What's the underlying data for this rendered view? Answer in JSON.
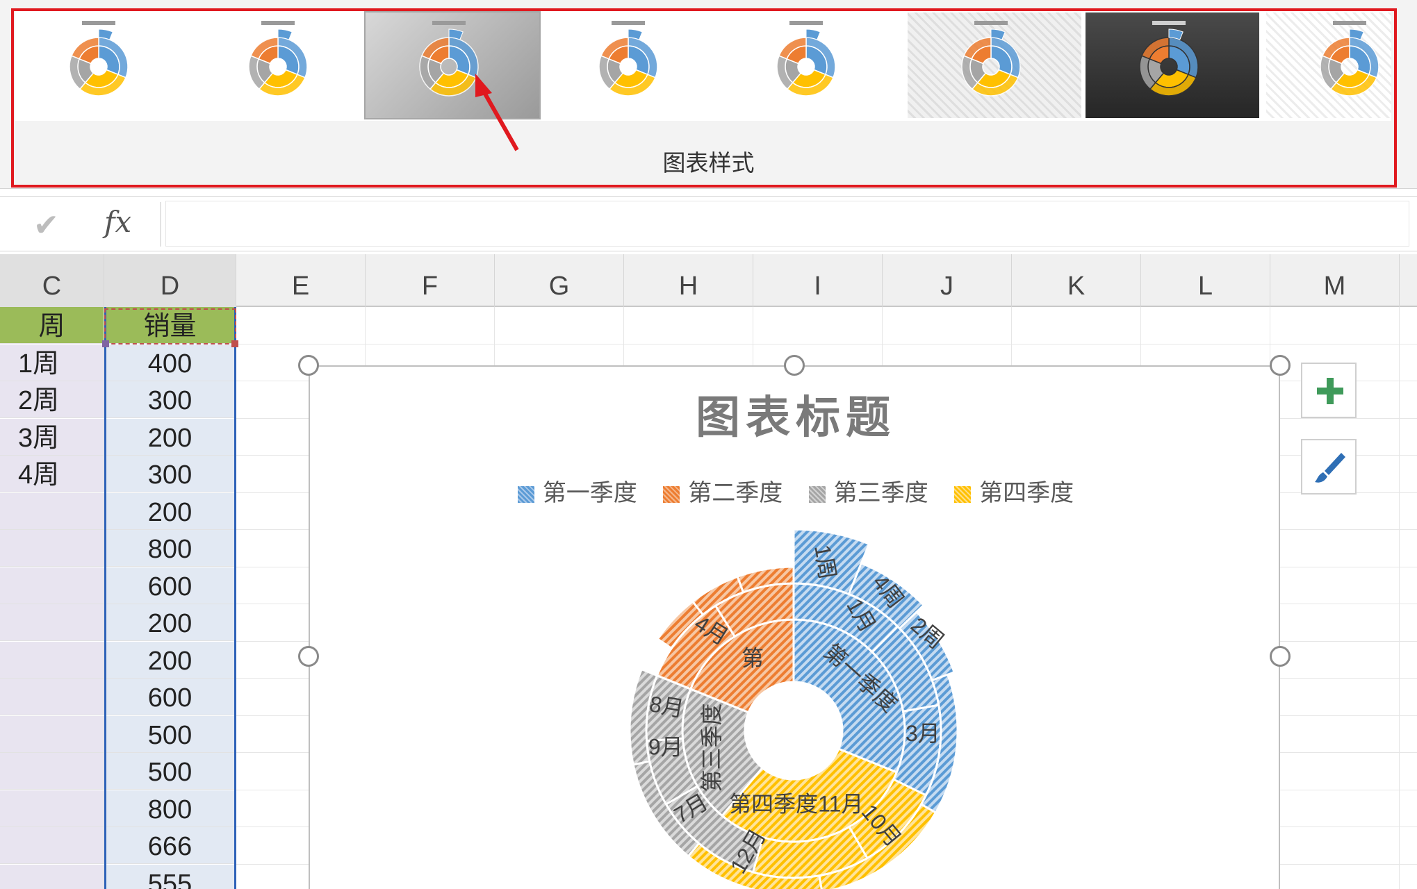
{
  "ribbon": {
    "group_label": "图表样式",
    "styles": [
      {
        "name": "style-1"
      },
      {
        "name": "style-2"
      },
      {
        "name": "style-3"
      },
      {
        "name": "style-4"
      },
      {
        "name": "style-5"
      },
      {
        "name": "style-6"
      },
      {
        "name": "style-7"
      },
      {
        "name": "style-8"
      }
    ],
    "selected_style_index": 2
  },
  "formula_bar": {
    "check_icon": "check-icon",
    "fx_label": "fx",
    "value": ""
  },
  "columns": [
    "C",
    "D",
    "E",
    "F",
    "G",
    "H",
    "I",
    "J",
    "K",
    "L",
    "M"
  ],
  "sheet": {
    "header_row": {
      "C": "周",
      "D": "销量"
    },
    "rows": [
      {
        "C": "1周",
        "D": "400"
      },
      {
        "C": "2周",
        "D": "300"
      },
      {
        "C": "3周",
        "D": "200"
      },
      {
        "C": "4周",
        "D": "300"
      },
      {
        "C": "",
        "D": "200"
      },
      {
        "C": "",
        "D": "800"
      },
      {
        "C": "",
        "D": "600"
      },
      {
        "C": "",
        "D": "200"
      },
      {
        "C": "",
        "D": "200"
      },
      {
        "C": "",
        "D": "600"
      },
      {
        "C": "",
        "D": "500"
      },
      {
        "C": "",
        "D": "500"
      },
      {
        "C": "",
        "D": "800"
      },
      {
        "C": "",
        "D": "666"
      },
      {
        "C": "",
        "D": "555"
      }
    ]
  },
  "chart": {
    "title": "图表标题",
    "legend": [
      {
        "label": "第一季度",
        "color": "#5b9bd5"
      },
      {
        "label": "第二季度",
        "color": "#ed7d31"
      },
      {
        "label": "第三季度",
        "color": "#a5a5a5"
      },
      {
        "label": "第四季度",
        "color": "#ffc000"
      }
    ],
    "labels": {
      "q1": "第一季度",
      "q2": "第",
      "q3": "第三季度",
      "q4": "第四季度11月",
      "m1": "1月",
      "m3": "3月",
      "m4": "4月",
      "m7": "7月",
      "m8": "8月",
      "m9": "9月",
      "m10": "10月",
      "m12": "12月",
      "w1": "1周",
      "w2": "2周",
      "w4": "4周"
    }
  },
  "chart_data": {
    "type": "sunburst",
    "title": "图表标题",
    "series": [
      {
        "name": "第一季度"
      },
      {
        "name": "第二季度"
      },
      {
        "name": "第三季度"
      },
      {
        "name": "第四季度"
      }
    ],
    "values": [
      400,
      300,
      200,
      300,
      200,
      800,
      600,
      200,
      200,
      600,
      500,
      500,
      800,
      666,
      555
    ]
  },
  "side_buttons": [
    {
      "icon": "plus-icon"
    },
    {
      "icon": "brush-icon"
    }
  ]
}
